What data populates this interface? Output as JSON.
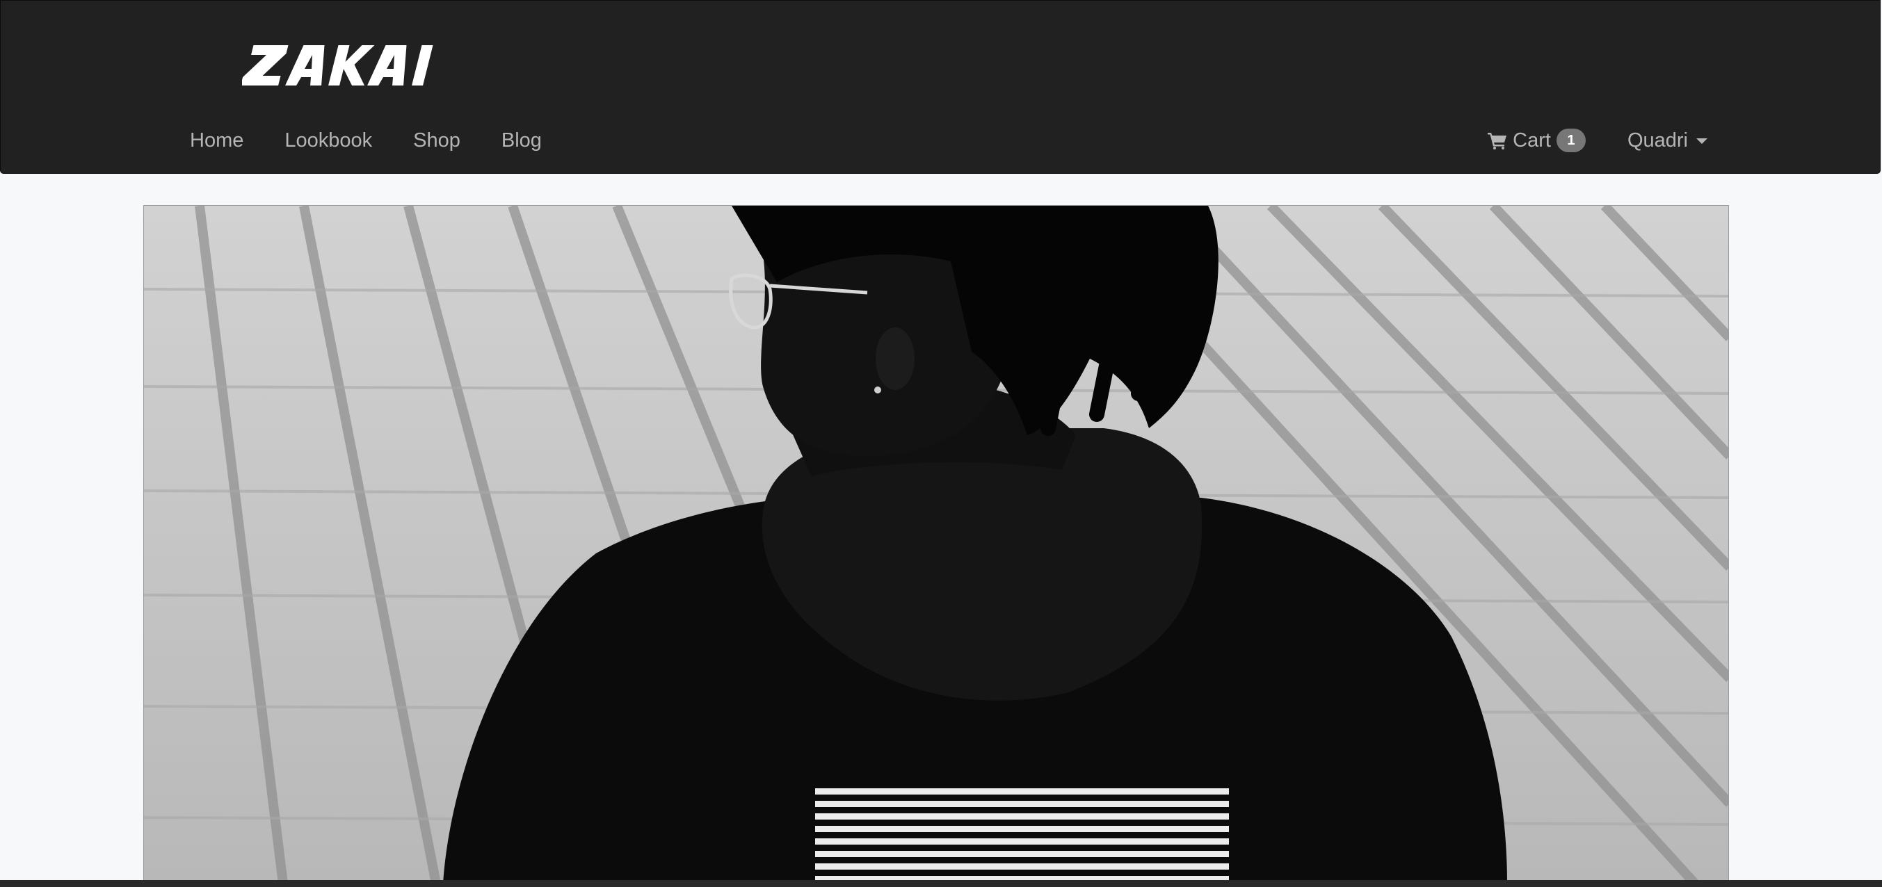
{
  "brand": {
    "logo_text": "ZAKAI"
  },
  "nav": {
    "links": [
      "Home",
      "Lookbook",
      "Shop",
      "Blog"
    ]
  },
  "cart": {
    "label": "Cart",
    "count": "1",
    "icon": "shopping-cart-icon"
  },
  "user": {
    "name": "Quadri",
    "icon": "caret-down-icon"
  },
  "hero": {
    "image": "black-and-white photo of a person with dreadlocks and glasses wearing a black hoodie with white stripes, seen from behind on a paved street"
  },
  "colors": {
    "navbar_bg": "#212121",
    "nav_text": "#b5b5b5",
    "page_bg": "#f6f8fa",
    "badge_bg": "#777777"
  }
}
